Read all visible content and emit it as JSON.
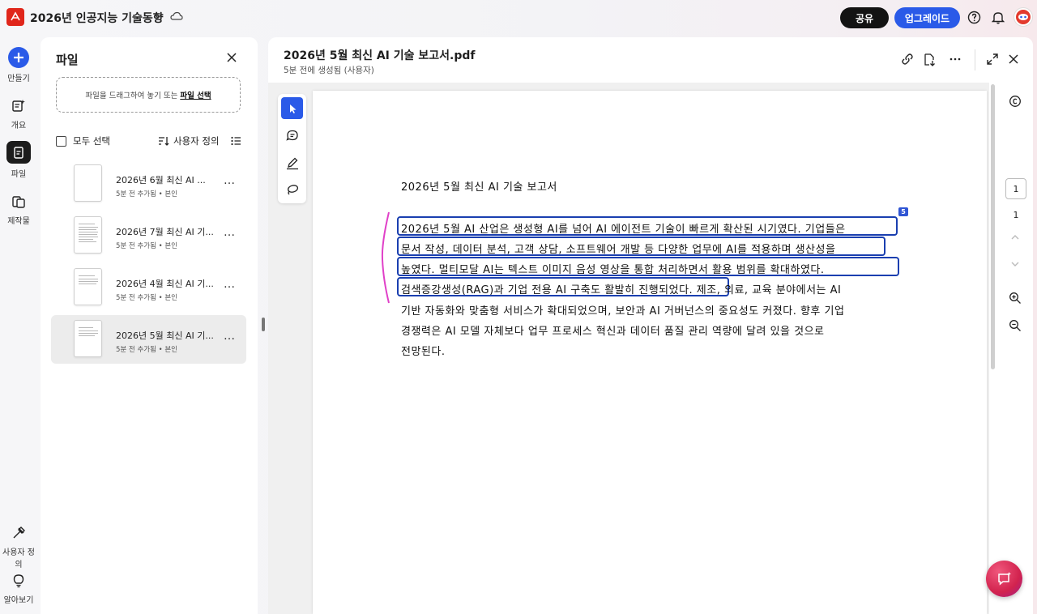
{
  "topbar": {
    "app_logo": "acrobat-logo",
    "document_title": "2026년 인공지능 기술동향",
    "share_label": "공유",
    "upgrade_label": "업그레이드"
  },
  "rail": {
    "create_label": "만들기",
    "overview_label": "개요",
    "files_label": "파일",
    "creations_label": "제작물",
    "customize_label": "사용자 정의",
    "learn_label": "알아보기"
  },
  "files_panel": {
    "title": "파일",
    "dropzone_text": "파일을 드래그하여 놓기 또는",
    "dropzone_link": "파일 선택",
    "select_all_label": "모두 선택",
    "sort_label": "사용자 정의",
    "items": [
      {
        "name": "2026년 6월 최신 AI ...",
        "meta": "5분 전 추가됨 • 본인",
        "selected": false
      },
      {
        "name": "2026년 7월 최신 AI 기...",
        "meta": "5분 전 추가됨 • 본인",
        "selected": false
      },
      {
        "name": "2026년 4월 최신 AI 기...",
        "meta": "5분 전 추가됨 • 본인",
        "selected": false
      },
      {
        "name": "2026년 5월 최신 AI 기...",
        "meta": "5분 전 추가됨 • 본인",
        "selected": true
      }
    ]
  },
  "viewer": {
    "file_name": "2026년 5월 최신 AI 기술 보고서.pdf",
    "subtitle": "5분 전에 생성됨 (사용자)",
    "current_page": "1",
    "total_pages": "1",
    "selection_badge": "5"
  },
  "pdf": {
    "heading": "2026년 5월 최신 AI 기술 보고서",
    "lines": [
      "2026년 5월 AI 산업은 생성형 AI를 넘어 AI 에이전트 기술이 빠르게 확산된 시기였다. 기업들은",
      "문서 작성, 데이터 분석, 고객 상담, 소프트웨어 개발 등 다양한 업무에 AI를 적용하며 생산성을",
      "높였다. 멀티모달 AI는 텍스트   이미지   음성   영상을 통합 처리하면서 활용 범위를 확대하였다.",
      "검색증강생성(RAG)과 기업 전용 AI 구축도 활발히 진행되었다. 제조, 의료, 교육 분야에서는 AI",
      "기반 자동화와 맞춤형 서비스가 확대되었으며, 보안과 AI 거버넌스의 중요성도 커졌다. 향후 기업",
      "경쟁력은 AI 모델 자체보다 업무 프로세스 혁신과 데이터 품질 관리 역량에 달려 있을 것으로",
      "전망된다."
    ]
  },
  "colors": {
    "accent_blue": "#2a5ae8",
    "selection_border": "#1a3fb0",
    "annotation_mark": "#e040c8",
    "acrobat_red": "#e0261b"
  }
}
